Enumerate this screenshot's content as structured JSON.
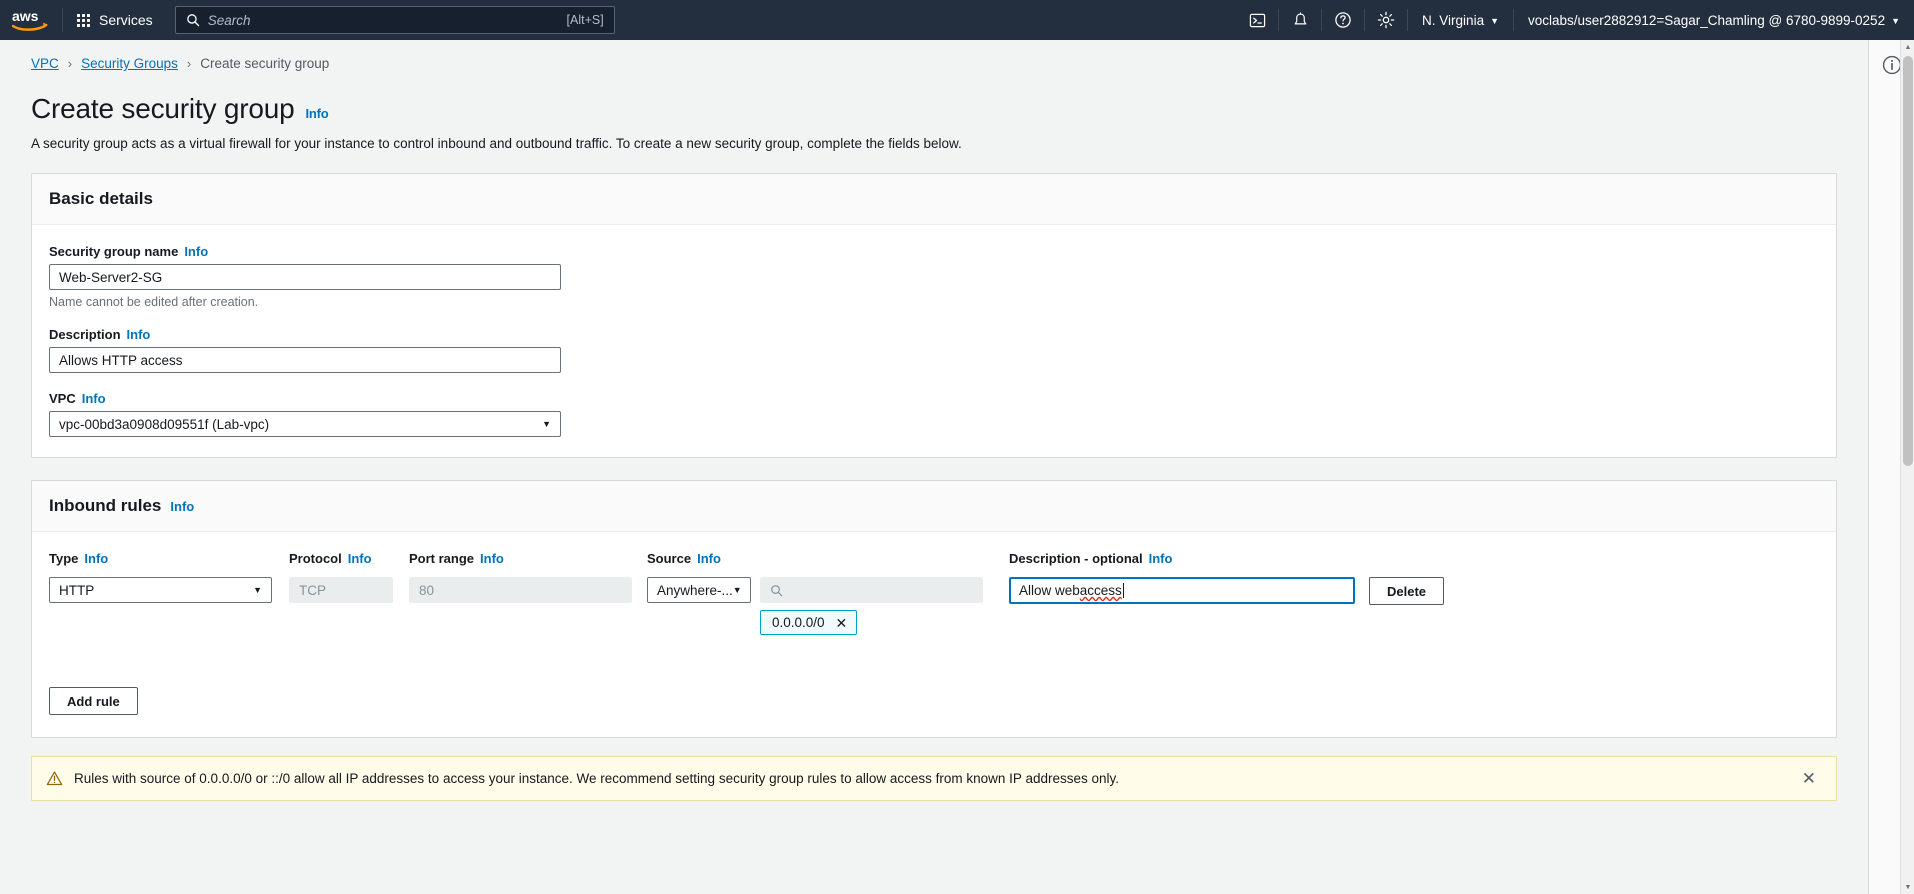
{
  "topnav": {
    "logo_alt": "aws",
    "services_label": "Services",
    "search": {
      "placeholder": "Search",
      "shortcut": "[Alt+S]"
    },
    "icons": [
      "cloudshell-icon",
      "bell-icon",
      "help-icon",
      "settings-icon"
    ],
    "region": "N. Virginia",
    "account": "voclabs/user2882912=Sagar_Chamling @ 6780-9899-0252"
  },
  "breadcrumb": {
    "items": [
      {
        "label": "VPC",
        "link": true
      },
      {
        "label": "Security Groups",
        "link": true
      },
      {
        "label": "Create security group",
        "link": false
      }
    ],
    "separator": "›"
  },
  "header": {
    "title": "Create security group",
    "info_label": "Info",
    "description": "A security group acts as a virtual firewall for your instance to control inbound and outbound traffic. To create a new security group, complete the fields below."
  },
  "basic_details": {
    "section_title": "Basic details",
    "name_label": "Security group name",
    "name_info": "Info",
    "name_value": "Web-Server2-SG",
    "name_hint": "Name cannot be edited after creation.",
    "description_label": "Description",
    "description_info": "Info",
    "description_value": "Allows HTTP access",
    "vpc_label": "VPC",
    "vpc_info": "Info",
    "vpc_value": "vpc-00bd3a0908d09551f (Lab-vpc)"
  },
  "inbound_rules": {
    "section_title": "Inbound rules",
    "section_info": "Info",
    "columns": [
      {
        "label": "Type",
        "info": "Info"
      },
      {
        "label": "Protocol",
        "info": "Info"
      },
      {
        "label": "Port range",
        "info": "Info"
      },
      {
        "label": "Source",
        "info": "Info"
      },
      {
        "label": "Description - optional",
        "info": "Info"
      }
    ],
    "rows": [
      {
        "type": "HTTP",
        "protocol": "TCP",
        "port_range": "80",
        "source_type": "Anywhere-...",
        "source_search_placeholder": "",
        "source_token": "0.0.0.0/0",
        "description": "Allow web access",
        "description_spell_word": "access",
        "delete_label": "Delete"
      }
    ],
    "add_rule_label": "Add rule"
  },
  "warning": {
    "text": "Rules with source of 0.0.0.0/0 or ::/0 allow all IP addresses to access your instance. We recommend setting security group rules to allow access from known IP addresses only.",
    "icon": "warning-triangle-icon",
    "close": "✕"
  },
  "colors": {
    "nav_bg": "#232f3e",
    "link": "#0073bb",
    "page_bg": "#f2f3f3",
    "warn_bg": "#fffce9",
    "warn_border": "#e9dfa0",
    "token_border": "#00a1c9",
    "focus_border": "#0073bb"
  }
}
